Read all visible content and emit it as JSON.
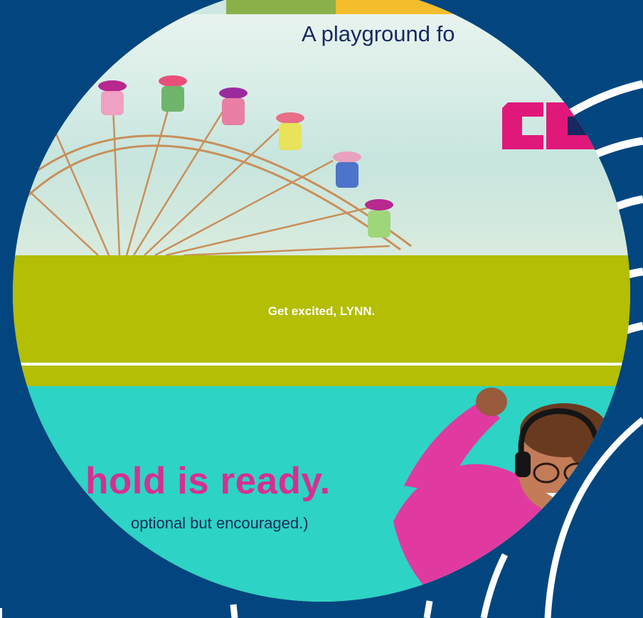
{
  "hero": {
    "tagline": "A playground fo",
    "logo_icon": "cp-logo-icon",
    "image": "ferris-wheel-icon"
  },
  "banner": {
    "greeting": "Get excited, LYNN."
  },
  "promo": {
    "headline": "hold is ready.",
    "subline": "optional but encouraged.)",
    "image": "woman-with-headphones-icon"
  },
  "colors": {
    "background": "#03467f",
    "banner_green": "#b3be04",
    "promo_teal": "#2dd3c4",
    "headline_pink": "#d6308f",
    "logo_pink": "#e0187a",
    "logo_navy": "#17295e"
  }
}
